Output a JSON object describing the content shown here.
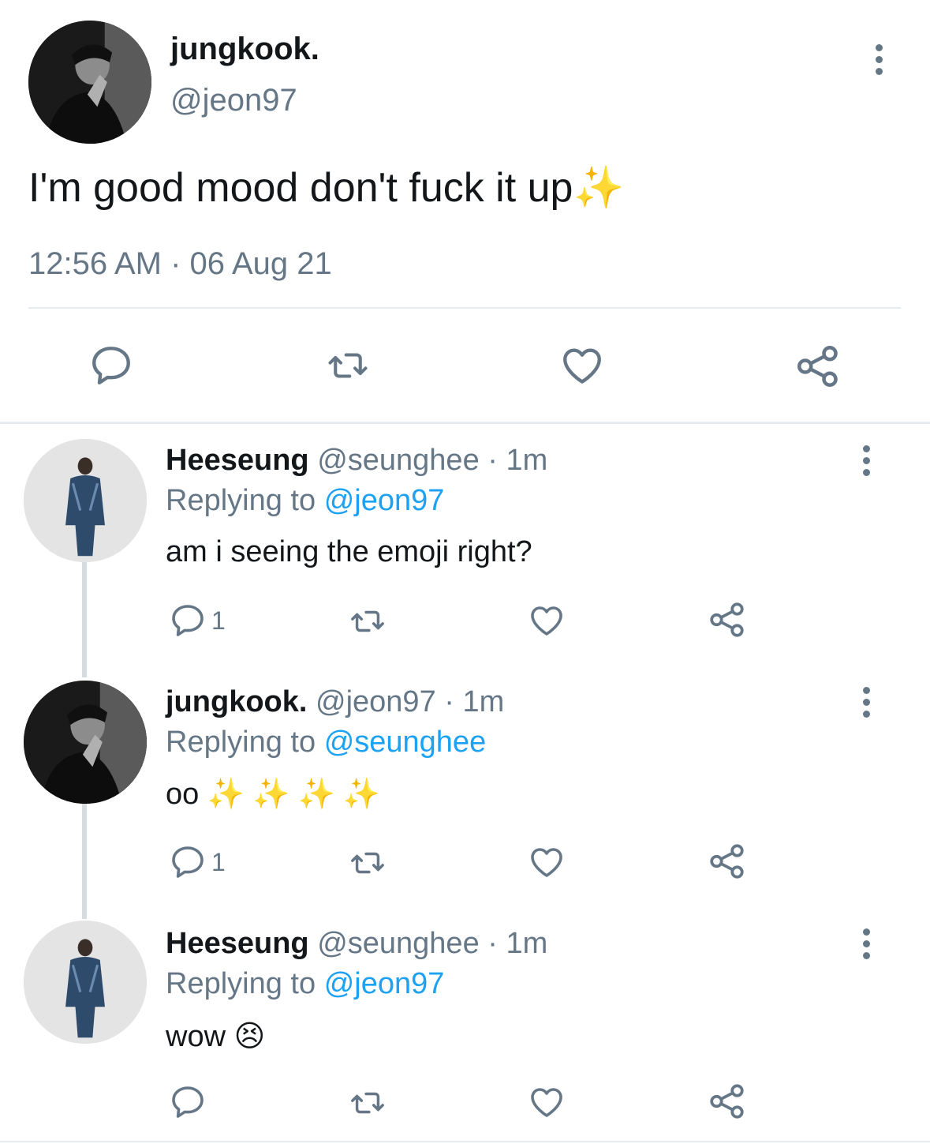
{
  "main_tweet": {
    "display_name": "jungkook.",
    "handle": "@jeon97",
    "text": "I'm good mood don't fuck it up",
    "emoji": "✨",
    "timestamp": "12:56 AM · 06 Aug 21",
    "avatar_icon": "profile-photo-dark"
  },
  "replies": [
    {
      "display_name": "Heeseung",
      "handle": "@seunghee",
      "time": "· 1m",
      "replying_label": "Replying to",
      "replying_to": "@jeon97",
      "text": "am i seeing the emoji right?",
      "emoji": "",
      "reply_count": "1"
    },
    {
      "display_name": "jungkook.",
      "handle": "@jeon97",
      "time": "· 1m",
      "replying_label": "Replying to",
      "replying_to": "@seunghee",
      "text": "oo",
      "emoji": "✨✨✨✨",
      "reply_count": "1"
    },
    {
      "display_name": "Heeseung",
      "handle": "@seunghee",
      "time": "· 1m",
      "replying_label": "Replying to",
      "replying_to": "@jeon97",
      "text": "wow",
      "emoji": "😣",
      "reply_count": ""
    }
  ],
  "colors": {
    "text": "#14171a",
    "muted": "#657786",
    "link": "#1da1f2",
    "divider": "#e6ecf0",
    "sparkle": "#f5c518"
  }
}
